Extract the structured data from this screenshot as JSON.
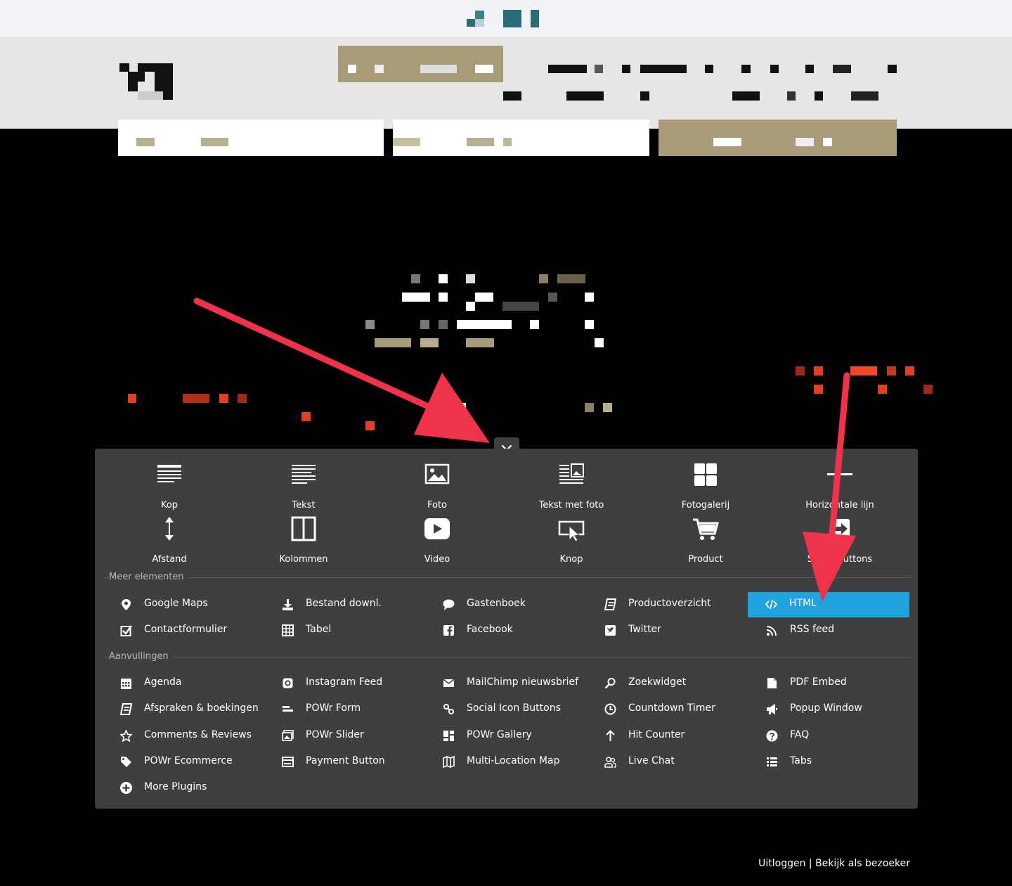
{
  "elements": [
    {
      "label": "Kop",
      "icon": "heading-icon"
    },
    {
      "label": "Tekst",
      "icon": "text-icon"
    },
    {
      "label": "Foto",
      "icon": "photo-icon"
    },
    {
      "label": "Tekst met foto",
      "icon": "text-with-photo-icon"
    },
    {
      "label": "Fotogalerij",
      "icon": "gallery-icon"
    },
    {
      "label": "Horizontale lijn",
      "icon": "horizontal-line-icon"
    },
    {
      "label": "Afstand",
      "icon": "spacing-icon"
    },
    {
      "label": "Kolommen",
      "icon": "columns-icon"
    },
    {
      "label": "Video",
      "icon": "video-icon"
    },
    {
      "label": "Knop",
      "icon": "button-icon"
    },
    {
      "label": "Product",
      "icon": "cart-icon"
    },
    {
      "label": "Social buttons",
      "icon": "share-icon"
    }
  ],
  "sections": {
    "more": "Meer elementen",
    "addons": "Aanvullingen"
  },
  "more_items": [
    {
      "label": "Google Maps",
      "icon": "map-pin-icon"
    },
    {
      "label": "Bestand downl.",
      "icon": "download-icon"
    },
    {
      "label": "Gastenboek",
      "icon": "speech-bubble-icon"
    },
    {
      "label": "Productoverzicht",
      "icon": "book-icon"
    },
    {
      "label": "HTML",
      "icon": "code-icon",
      "active": true
    },
    {
      "label": "Contactformulier",
      "icon": "checkbox-icon"
    },
    {
      "label": "Tabel",
      "icon": "table-icon"
    },
    {
      "label": "Facebook",
      "icon": "facebook-icon"
    },
    {
      "label": "Twitter",
      "icon": "twitter-icon"
    },
    {
      "label": "RSS feed",
      "icon": "rss-icon"
    }
  ],
  "addon_items": [
    {
      "label": "Agenda",
      "icon": "calendar-icon"
    },
    {
      "label": "Instagram Feed",
      "icon": "instagram-icon"
    },
    {
      "label": "MailChimp nieuwsbrief",
      "icon": "envelope-icon"
    },
    {
      "label": "Zoekwidget",
      "icon": "search-icon"
    },
    {
      "label": "PDF Embed",
      "icon": "pdf-icon"
    },
    {
      "label": "Afspraken & boekingen",
      "icon": "booking-icon"
    },
    {
      "label": "POWr Form",
      "icon": "form-icon"
    },
    {
      "label": "Social Icon Buttons",
      "icon": "link-icon"
    },
    {
      "label": "Countdown Timer",
      "icon": "clock-icon"
    },
    {
      "label": "Popup Window",
      "icon": "megaphone-icon"
    },
    {
      "label": "Comments & Reviews",
      "icon": "star-icon"
    },
    {
      "label": "POWr Slider",
      "icon": "slider-icon"
    },
    {
      "label": "POWr Gallery",
      "icon": "grid-gallery-icon"
    },
    {
      "label": "Hit Counter",
      "icon": "arrow-up-icon"
    },
    {
      "label": "FAQ",
      "icon": "question-icon"
    },
    {
      "label": "POWr Ecommerce",
      "icon": "tag-icon"
    },
    {
      "label": "Payment Button",
      "icon": "payment-icon"
    },
    {
      "label": "Multi-Location Map",
      "icon": "map-icon"
    },
    {
      "label": "Live Chat",
      "icon": "chat-users-icon"
    },
    {
      "label": "Tabs",
      "icon": "list-icon"
    },
    {
      "label": "More Plugins",
      "icon": "plus-circle-icon"
    }
  ],
  "footer": {
    "logout": "Uitloggen",
    "separator": " | ",
    "view_as_visitor": "Bekijk als bezoeker"
  },
  "colors": {
    "panel": "#3f3f3f",
    "active": "#21a3e0",
    "annotation_arrow": "#f0334a"
  }
}
